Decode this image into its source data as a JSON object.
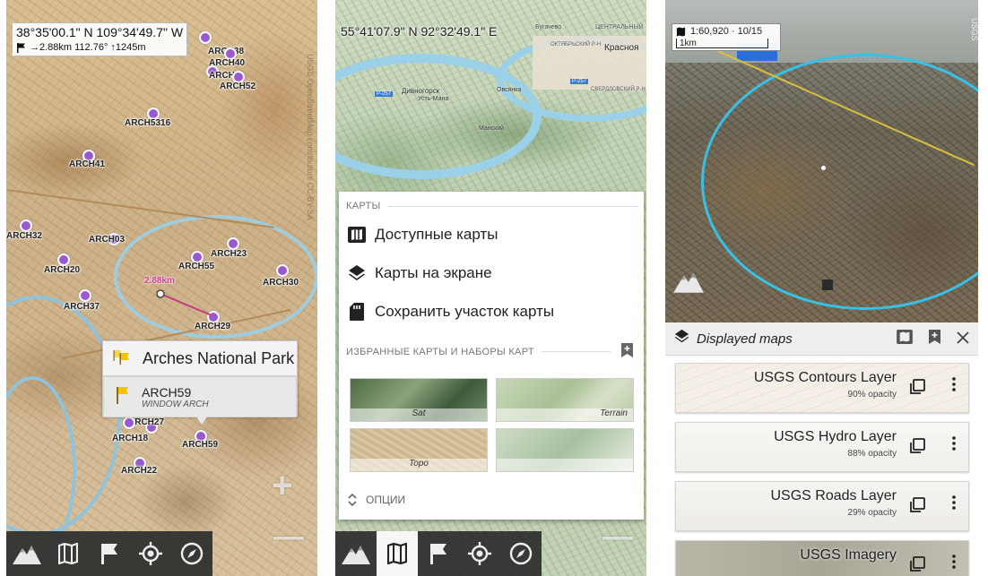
{
  "panel1": {
    "coords": "38°35'00.1\" N 109°34'49.7\" W",
    "nav_info": "→2.88km 112.76° ↑1245m",
    "attribution": "USGS OpenStreetMap contributors CC-BY-SA",
    "distance": "2.88km",
    "pois": [
      "ARCH38",
      "ARCH40",
      "ARCH4",
      "ARCH52",
      "ARCH5316",
      "ARCH41",
      "ARCH32",
      "ARCH03",
      "ARCH23",
      "ARCH55",
      "ARCH20",
      "ARCH30",
      "ARCH37",
      "ARCH29",
      "ARCH27",
      "ARCH18",
      "ARCH59",
      "ARCH22"
    ],
    "popup": {
      "title": "Arches National Park",
      "item_name": "ARCH59",
      "item_sub": "WINDOW ARCH"
    },
    "toolbar_icons": [
      "mountain-icon",
      "map-icon",
      "flag-icon",
      "crosshair-icon",
      "compass-icon"
    ],
    "zoom_in": "+",
    "zoom_out": "—"
  },
  "panel2": {
    "coords": "55°41'07.9\" N 92°32'49.1\" E",
    "map_labels": [
      "Красноя",
      "Дивногорск",
      "Овсянка",
      "Усть-Мана",
      "Манский",
      "Бугачево",
      "ЦЕНТРАЛЬНЫЙ",
      "ОКТЯБРЬСКИЙ Р-Н",
      "СВЕРДЛОВСКИЙ Р-Н",
      "P-257",
      "P-257"
    ],
    "section_maps": "КАРТЫ",
    "menu_items": [
      {
        "label": "Доступные карты",
        "icon": "maps-icon"
      },
      {
        "label": "Карты на экране",
        "icon": "layers-icon"
      },
      {
        "label": "Сохранить участок карты",
        "icon": "sd-card-icon"
      }
    ],
    "section_favorites": "ИЗБРАННЫЕ КАРТЫ И НАБОРЫ КАРТ",
    "thumbnails": [
      {
        "label": "Sat"
      },
      {
        "label": "Terrain"
      },
      {
        "label": "Topo"
      },
      {
        "label": ""
      }
    ],
    "options_label": "ОПЦИИ",
    "toolbar_icons": [
      "mountain-icon",
      "map-icon",
      "flag-icon",
      "crosshair-icon",
      "compass-icon"
    ]
  },
  "panel3": {
    "scale_text": "1:60,920 · 10/15",
    "scale_bar_label": "1km",
    "attribution": "USGS",
    "header_title": "Displayed maps",
    "layers": [
      {
        "name": "USGS Contours Layer",
        "opacity": "90% opacity"
      },
      {
        "name": "USGS Hydro Layer",
        "opacity": "88% opacity"
      },
      {
        "name": "USGS Roads Layer",
        "opacity": "29% opacity"
      },
      {
        "name": "USGS Imagery",
        "opacity": ""
      }
    ]
  }
}
